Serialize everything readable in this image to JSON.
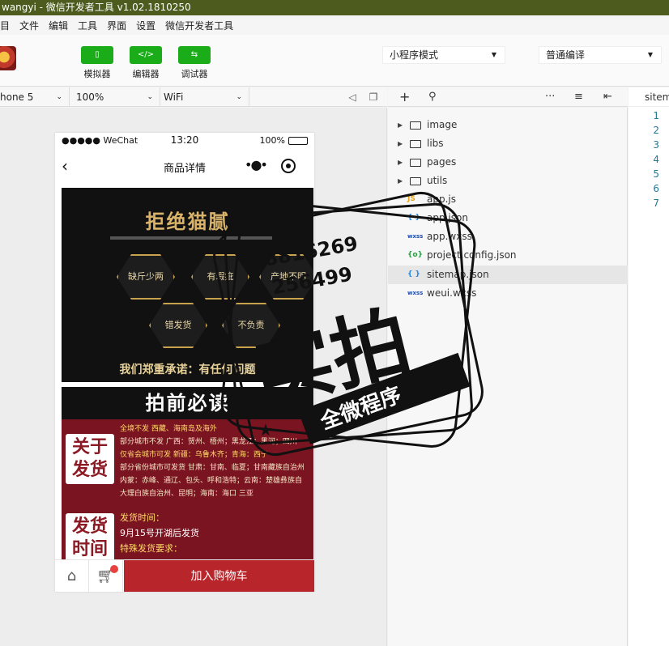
{
  "window": {
    "title": "wangyi - 微信开发者工具 v1.02.1810250"
  },
  "menu": [
    "目",
    "文件",
    "编辑",
    "工具",
    "界面",
    "设置",
    "微信开发者工具"
  ],
  "toolbar": {
    "simulator_label": "模拟器",
    "editor_label": "编辑器",
    "debugger_label": "调试器",
    "mode_select": "小程序模式",
    "compile_select": "普通编译"
  },
  "devbar": {
    "device": "hone 5",
    "zoom": "100%",
    "network": "WiFi"
  },
  "phone": {
    "carrier": "●●●●● WeChat",
    "time": "13:20",
    "battery_text": "100%",
    "battery_level": 1.0,
    "nav_title": "商品详情",
    "banner1_title": "拒绝猫腻",
    "banner1_hexes": [
      "缺斤少两",
      "有瑕疵",
      "产地不明",
      "错发货",
      "不负责"
    ],
    "banner1_footer": "我们郑重承诺：有任何问题",
    "banner2_title": "拍前必读",
    "tag_shipping": "关于发货",
    "tag_time": "发货时间",
    "shipping_lines": [
      "全境不发  西藏、海南岛及海外",
      "部分城市不发  广西：贺州、梧州；黑龙江：黑河；四川",
      "仅省会城市可发  新疆：乌鲁木齐；青海：西宁",
      "部分省份城市可发货  甘肃：甘南、临夏；甘南藏族自治州",
      "内蒙：赤峰、通辽、包头、呼和浩特；云南：楚雄彝族自",
      "大理白族自治州、昆明；海南：海口  三亚"
    ],
    "time_title": "发货时间：",
    "time_text": "9月15号开湖后发货",
    "special_title": "特殊发货要求：",
    "add_to_cart": "加入购物车"
  },
  "files": [
    {
      "name": "image",
      "type": "folder"
    },
    {
      "name": "libs",
      "type": "folder"
    },
    {
      "name": "pages",
      "type": "folder"
    },
    {
      "name": "utils",
      "type": "folder"
    },
    {
      "name": "app.js",
      "type": "js",
      "icon": "JS"
    },
    {
      "name": "app.json",
      "type": "json",
      "icon": "{ }"
    },
    {
      "name": "app.wxss",
      "type": "wxss",
      "icon": "wxss"
    },
    {
      "name": "project.config.json",
      "type": "config",
      "icon": "{o}"
    },
    {
      "name": "sitemap.json",
      "type": "json",
      "icon": "{ }"
    },
    {
      "name": "weui.wxss",
      "type": "wxss",
      "icon": "wxss"
    }
  ],
  "editor": {
    "tab": "sitemap.json",
    "line_numbers": [
      "1",
      "2",
      "3",
      "4",
      "5",
      "6",
      "7"
    ]
  },
  "watermark": {
    "line1": "18816269",
    "line2": "256499",
    "big": "实拍",
    "ribbon": "全微程序"
  },
  "colors": {
    "titlebar": "#4d5c1e",
    "wechat_green": "#1aad19",
    "cart_red": "#b8252b",
    "banner_red": "#7a1421"
  }
}
